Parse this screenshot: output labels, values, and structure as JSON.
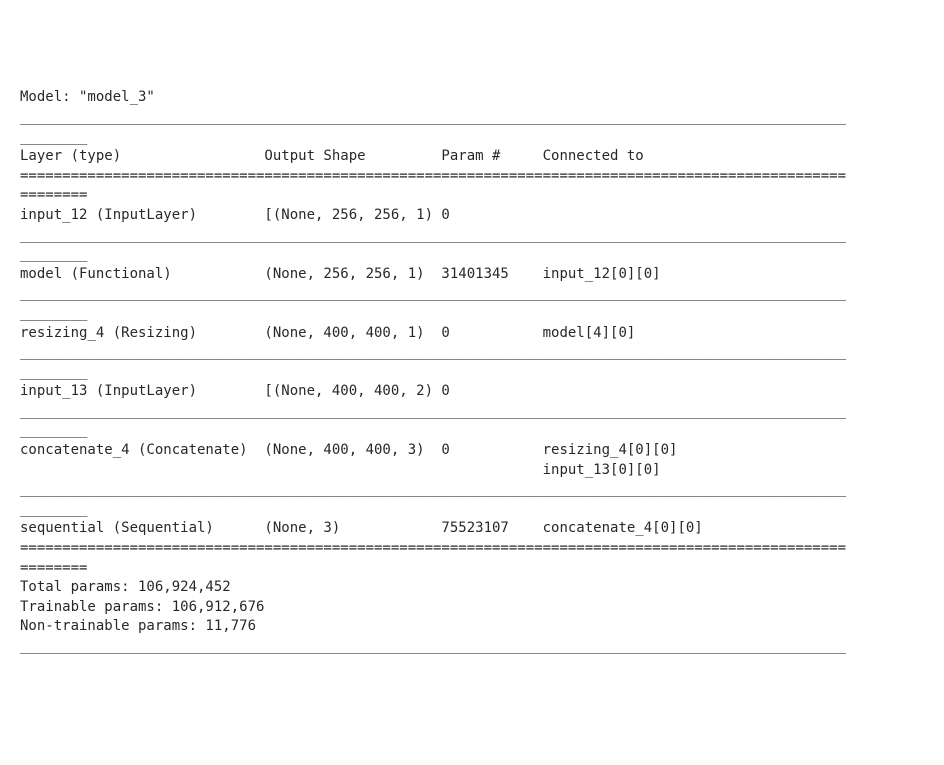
{
  "model_name_line": "Model: \"model_3\"",
  "header": {
    "layer": "Layer (type)",
    "output_shape": "Output Shape",
    "param": "Param #",
    "connected_to": "Connected to"
  },
  "layers": [
    {
      "name": "input_12 (InputLayer)",
      "output_shape": "[(None, 256, 256, 1)",
      "params": "0",
      "connected_to": [
        ""
      ]
    },
    {
      "name": "model (Functional)",
      "output_shape": "(None, 256, 256, 1)",
      "params": "31401345",
      "connected_to": [
        "input_12[0][0]"
      ]
    },
    {
      "name": "resizing_4 (Resizing)",
      "output_shape": "(None, 400, 400, 1)",
      "params": "0",
      "connected_to": [
        "model[4][0]"
      ]
    },
    {
      "name": "input_13 (InputLayer)",
      "output_shape": "[(None, 400, 400, 2)",
      "params": "0",
      "connected_to": [
        ""
      ]
    },
    {
      "name": "concatenate_4 (Concatenate)",
      "output_shape": "(None, 400, 400, 3)",
      "params": "0",
      "connected_to": [
        "resizing_4[0][0]",
        "input_13[0][0]"
      ]
    },
    {
      "name": "sequential (Sequential)",
      "output_shape": "(None, 3)",
      "params": "75523107",
      "connected_to": [
        "concatenate_4[0][0]"
      ]
    }
  ],
  "footer": {
    "total_params": "Total params: 106,924,452",
    "trainable_params": "Trainable params: 106,912,676",
    "non_trainable_params": "Non-trainable params: 11,776"
  },
  "separators": {
    "underscore_full": "__________________________________________________________________________________________________",
    "underscore_wrap": "________",
    "equals_full": "==================================================================================================",
    "equals_wrap": "========"
  },
  "col_widths": {
    "layer": 29,
    "output_shape": 21,
    "param": 12,
    "connected_to": 30
  }
}
